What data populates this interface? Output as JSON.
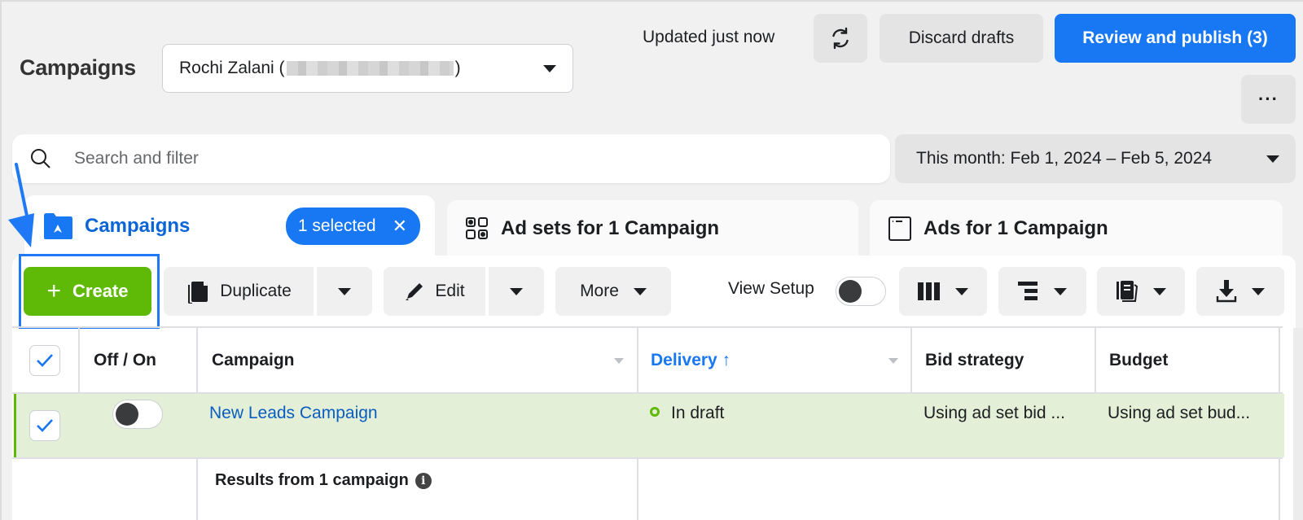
{
  "header": {
    "title": "Campaigns",
    "account_name_prefix": "Rochi Zalani (",
    "account_name_suffix": ")",
    "updated_text": "Updated just now",
    "discard_label": "Discard drafts",
    "publish_label": "Review and publish (3)",
    "overflow_label": "···"
  },
  "search": {
    "placeholder": "Search and filter",
    "value": ""
  },
  "date_range": {
    "label": "This month: Feb 1, 2024 – Feb 5, 2024"
  },
  "tabs": [
    {
      "label": "Campaigns",
      "selected_badge": "1 selected",
      "active": true
    },
    {
      "label": "Ad sets for 1 Campaign",
      "active": false
    },
    {
      "label": "Ads for 1 Campaign",
      "active": false
    }
  ],
  "toolbar": {
    "create_label": "Create",
    "duplicate_label": "Duplicate",
    "edit_label": "Edit",
    "more_label": "More",
    "view_setup_label": "View Setup",
    "view_setup_on": false
  },
  "table": {
    "columns": [
      {
        "label": "Off / On"
      },
      {
        "label": "Campaign"
      },
      {
        "label": "Delivery ↑",
        "sorted": true
      },
      {
        "label": "Bid strategy"
      },
      {
        "label": "Budget"
      }
    ],
    "rows": [
      {
        "selected": true,
        "on": false,
        "campaign": "New Leads Campaign",
        "delivery": "In draft",
        "bid_strategy": "Using ad set bid ...",
        "budget": "Using ad set bud..."
      }
    ],
    "summary": "Results from 1 campaign"
  },
  "colors": {
    "primary": "#1877f2",
    "create_green": "#5fba08",
    "selected_row": "#e3efd7",
    "link": "#0a5dc2"
  }
}
